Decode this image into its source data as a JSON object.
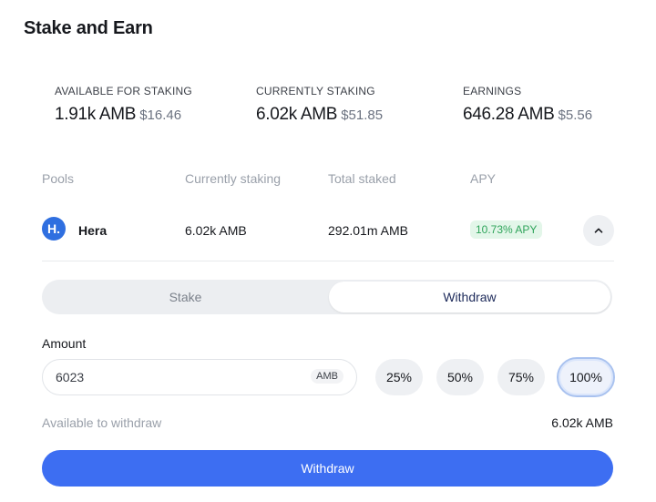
{
  "title": "Stake and Earn",
  "stats": [
    {
      "label": "AVAILABLE FOR STAKING",
      "amount": "1.91k AMB",
      "usd": "$16.46"
    },
    {
      "label": "CURRENTLY STAKING",
      "amount": "6.02k AMB",
      "usd": "$51.85"
    },
    {
      "label": "EARNINGS",
      "amount": "646.28 AMB",
      "usd": "$5.56"
    }
  ],
  "table": {
    "headers": [
      "Pools",
      "Currently staking",
      "Total staked",
      "APY"
    ]
  },
  "pool": {
    "logo_letter": "H.",
    "name": "Hera",
    "currently_staking": "6.02k AMB",
    "total_staked": "292.01m AMB",
    "apy": "10.73% APY",
    "collapse_icon": "chevron-up-icon"
  },
  "toggle": {
    "stake_label": "Stake",
    "withdraw_label": "Withdraw",
    "selected": "Withdraw"
  },
  "amount": {
    "label": "Amount",
    "value": "6023",
    "unit": "AMB"
  },
  "percent_options": [
    "25%",
    "50%",
    "75%",
    "100%"
  ],
  "selected_percent": "100%",
  "available": {
    "label": "Available to withdraw",
    "value": "6.02k AMB"
  },
  "primary_button": "Withdraw",
  "colors": {
    "accent": "#3d6ef2",
    "apy_badge_bg": "#e3f6e9",
    "apy_badge_text": "#2fa45a",
    "muted_text": "#9aa0aa"
  }
}
